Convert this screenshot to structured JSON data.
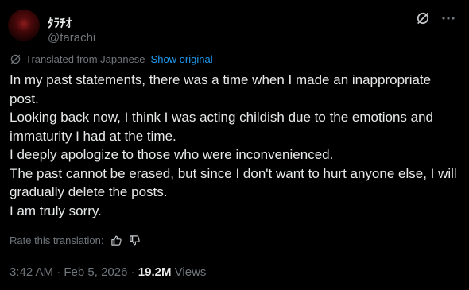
{
  "author": {
    "display_name": "ﾀﾗﾁｵ",
    "handle": "@tarachi"
  },
  "icons": {
    "grok": "grok-icon",
    "more": "more-icon",
    "translate": "globe-icon",
    "thumbs_up": "thumbs-up-icon",
    "thumbs_down": "thumbs-down-icon"
  },
  "translation": {
    "label": "Translated from Japanese",
    "show_original": "Show original"
  },
  "post": {
    "lines": [
      "In my past statements, there was a time when I made an inappropriate post.",
      "Looking back now, I think I was acting childish due to the emotions and immaturity I had at the time.",
      "I deeply apologize to those who were inconvenienced.",
      "The past cannot be erased, but since I don't want to hurt anyone else, I will gradually delete the posts.",
      "I am truly sorry."
    ]
  },
  "rating": {
    "label": "Rate this translation:"
  },
  "meta": {
    "time": "3:42 AM",
    "separator": "·",
    "date": "Feb 5, 2026",
    "views_count": "19.2M",
    "views_label": "Views"
  },
  "colors": {
    "background": "#000000",
    "text": "#e7e9ea",
    "secondary": "#71767b",
    "link": "#1d9bf0"
  }
}
